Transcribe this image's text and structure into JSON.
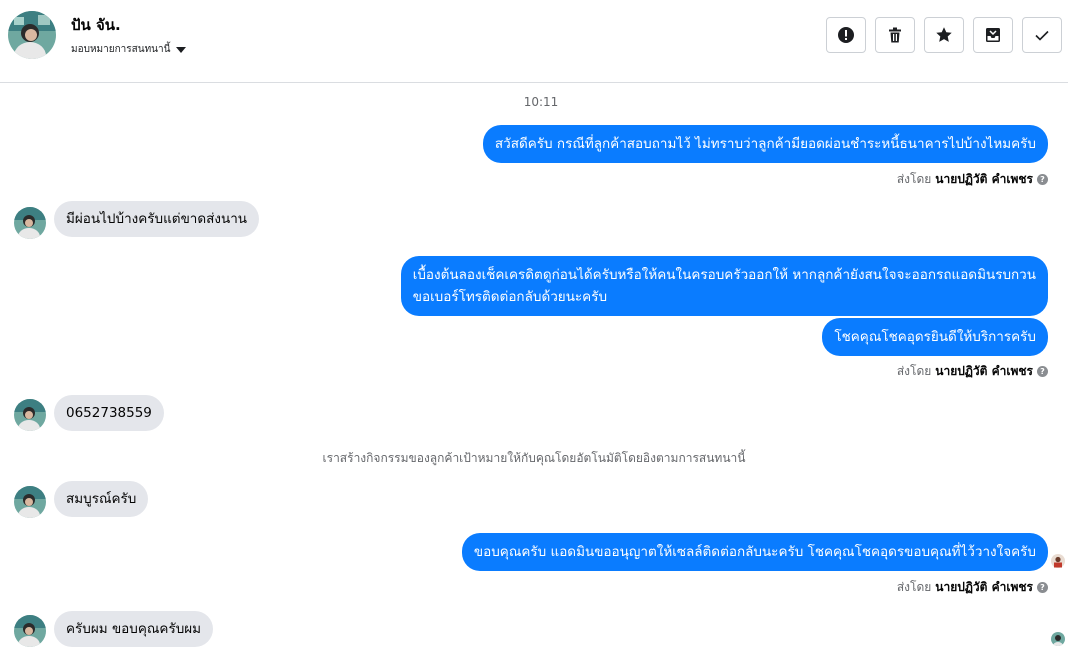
{
  "header": {
    "contact_name": "ปัน จัน.",
    "assign_label": "มอบหมายการสนทนานี้",
    "buttons": [
      {
        "name": "mark-spam-button",
        "icon": "exclamation-circle-icon"
      },
      {
        "name": "delete-button",
        "icon": "trash-icon"
      },
      {
        "name": "star-button",
        "icon": "star-icon"
      },
      {
        "name": "move-to-inbox-button",
        "icon": "inbox-icon"
      },
      {
        "name": "mark-done-button",
        "icon": "check-icon"
      }
    ]
  },
  "chat": {
    "time": "10:11",
    "messages": [
      {
        "dir": "out",
        "text": "สวัสดีครับ กรณีที่ลูกค้าสอบถามไว้ ไม่ทราบว่าลูกค้ามียอดผ่อนชำระหนี้ธนาคารไปบ้างไหมครับ"
      },
      {
        "dir": "in",
        "text": "มีผ่อนไปบ้างครับแต่ขาดส่งนาน"
      },
      {
        "dir": "out",
        "line1": "เบื้องต้นลองเช็คเครดิตดูก่อนได้ครับหรือให้คนในครอบครัวออกให้ หากลูกค้ายังสนใจจะออกรถแอดมินรบกวน",
        "line2": "ขอเบอร์โทรติดต่อกลับด้วยนะครับ"
      },
      {
        "dir": "out",
        "text": "โชคคุณโชคอุดรยินดีให้บริการครับ"
      },
      {
        "dir": "in",
        "text": "0652738559"
      },
      {
        "dir": "in",
        "text": "สมบูรณ์ครับ"
      },
      {
        "dir": "out",
        "text": "ขอบคุณครับ แอดมินขออนุญาตให้เซลล์ติดต่อกลับนะครับ โชคคุณโชคอุดรขอบคุณที่ไว้วางใจครับ"
      },
      {
        "dir": "in",
        "text": "ครับผม ขอบคุณครับผม"
      }
    ],
    "sent_by_prefix": "ส่งโดย",
    "sent_by_name": "นายปฏิวัติ คำเพชร",
    "system_notice": "เราสร้างกิจกรรมของลูกค้าเป้าหมายให้กับคุณโดยอัตโนมัติโดยอิงตามการสนทนานี้"
  },
  "colors": {
    "outgoing_bubble": "#0a7cff",
    "incoming_bubble": "#e4e6eb",
    "muted_text": "#65676b"
  }
}
